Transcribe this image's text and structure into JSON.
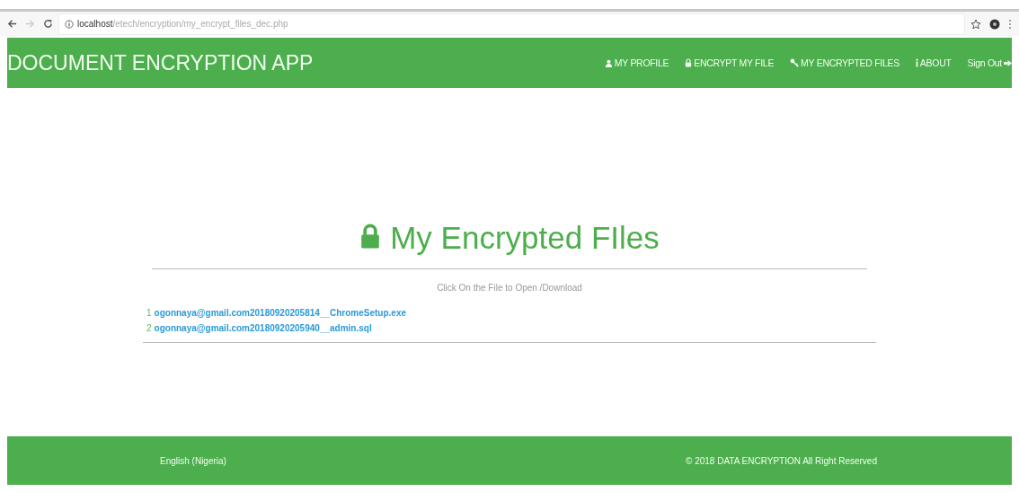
{
  "browser": {
    "url_host": "localhost",
    "url_path": "/etech/encryption/my_encrypt_files_dec.php"
  },
  "navbar": {
    "brand": "DOCUMENT ENCRYPTION APP",
    "items": [
      {
        "label": "MY PROFILE",
        "kind": "profile"
      },
      {
        "label": "ENCRYPT MY FILE",
        "kind": "encrypt"
      },
      {
        "label": "MY ENCRYPTED FILES",
        "kind": "files"
      },
      {
        "label": "ABOUT",
        "kind": "about"
      },
      {
        "label": "Sign Out",
        "kind": "signout"
      }
    ]
  },
  "page": {
    "title": "My Encrypted FIles",
    "hint": "Click On the File to Open /Download",
    "files": [
      {
        "number": "1",
        "name": "ogonnaya@gmail.com20180920205814__ChromeSetup.exe"
      },
      {
        "number": "2",
        "name": "ogonnaya@gmail.com20180920205940__admin.sql"
      }
    ]
  },
  "footer": {
    "language": "English (Nigeria)",
    "copyright": "© 2018 DATA ENCRYPTION All Right Reserved"
  }
}
